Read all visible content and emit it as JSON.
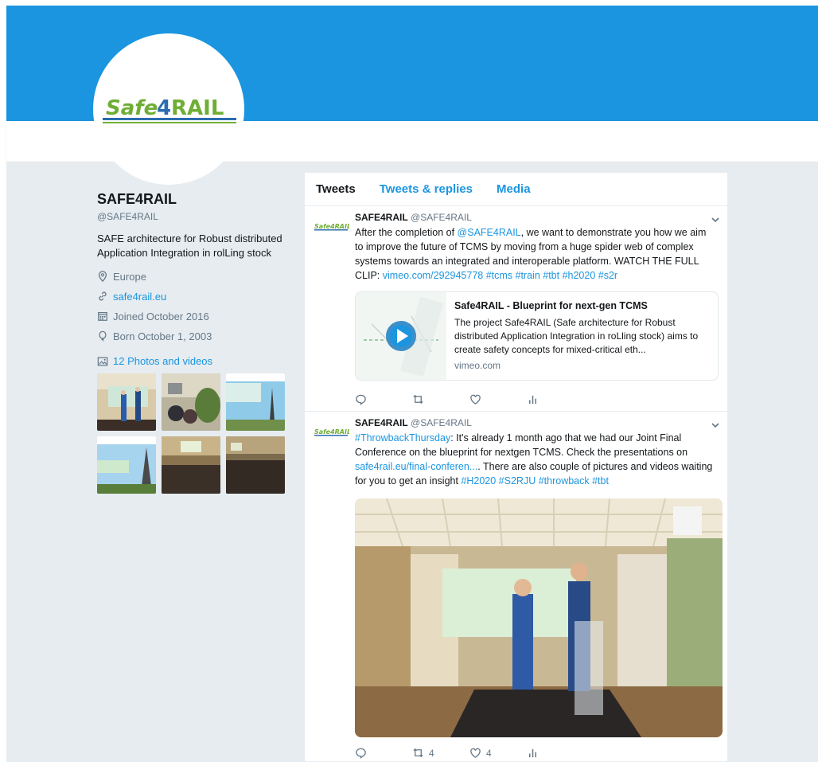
{
  "profile": {
    "logo_text": "Safe4RAIL",
    "name": "SAFE4RAIL",
    "handle": "@SAFE4RAIL",
    "bio": "SAFE architecture for Robust distributed Application Integration in rolLing stock",
    "location": "Europe",
    "website": "safe4rail.eu",
    "joined": "Joined October 2016",
    "born": "Born October 1, 2003",
    "photos_label": "12 Photos and videos"
  },
  "tabs": [
    {
      "label": "Tweets",
      "active": true
    },
    {
      "label": "Tweets & replies",
      "active": false
    },
    {
      "label": "Media",
      "active": false
    }
  ],
  "tweets": [
    {
      "name": "SAFE4RAIL",
      "handle": "@SAFE4RAIL",
      "text_parts": [
        "After the completion of ",
        "@SAFE4RAIL",
        ", we want to demonstrate you how we aim to improve the future of TCMS by moving from a huge spider web of complex systems towards an integrated and interoperable platform. WATCH THE FULL CLIP: ",
        "vimeo.com/292945778 #tcms #train #tbt #h2020 #s2r"
      ],
      "card": {
        "title": "Safe4RAIL - Blueprint for next-gen TCMS",
        "description": "The project Safe4RAIL (Safe architecture for Robust distributed Application Integration in roLling stock) aims to create safety concepts for mixed-critical eth...",
        "domain": "vimeo.com"
      },
      "replies": "",
      "retweets": "",
      "likes": ""
    },
    {
      "name": "SAFE4RAIL",
      "handle": "@SAFE4RAIL",
      "text_parts": [
        "#ThrowbackThursday",
        ": It's already 1 month ago that we had our Joint Final Conference on the blueprint for nextgen TCMS. Check the presentations on ",
        "safe4rail.eu/final-conferen...",
        ". There are also couple of pictures and videos waiting for you to get an insight ",
        "#H2020 #S2RJU #throwback #tbt"
      ],
      "replies": "",
      "retweets": "4",
      "likes": "4"
    }
  ],
  "colors": {
    "brand_blue": "#1b95e0",
    "page_bg": "#e6ecf0",
    "text_secondary": "#657786",
    "logo_green": "#6fae35"
  },
  "icons": [
    "location-icon",
    "link-icon",
    "calendar-icon",
    "balloon-icon",
    "photo-icon",
    "reply-icon",
    "retweet-icon",
    "like-icon",
    "analytics-icon",
    "chevron-down-icon",
    "play-icon"
  ]
}
